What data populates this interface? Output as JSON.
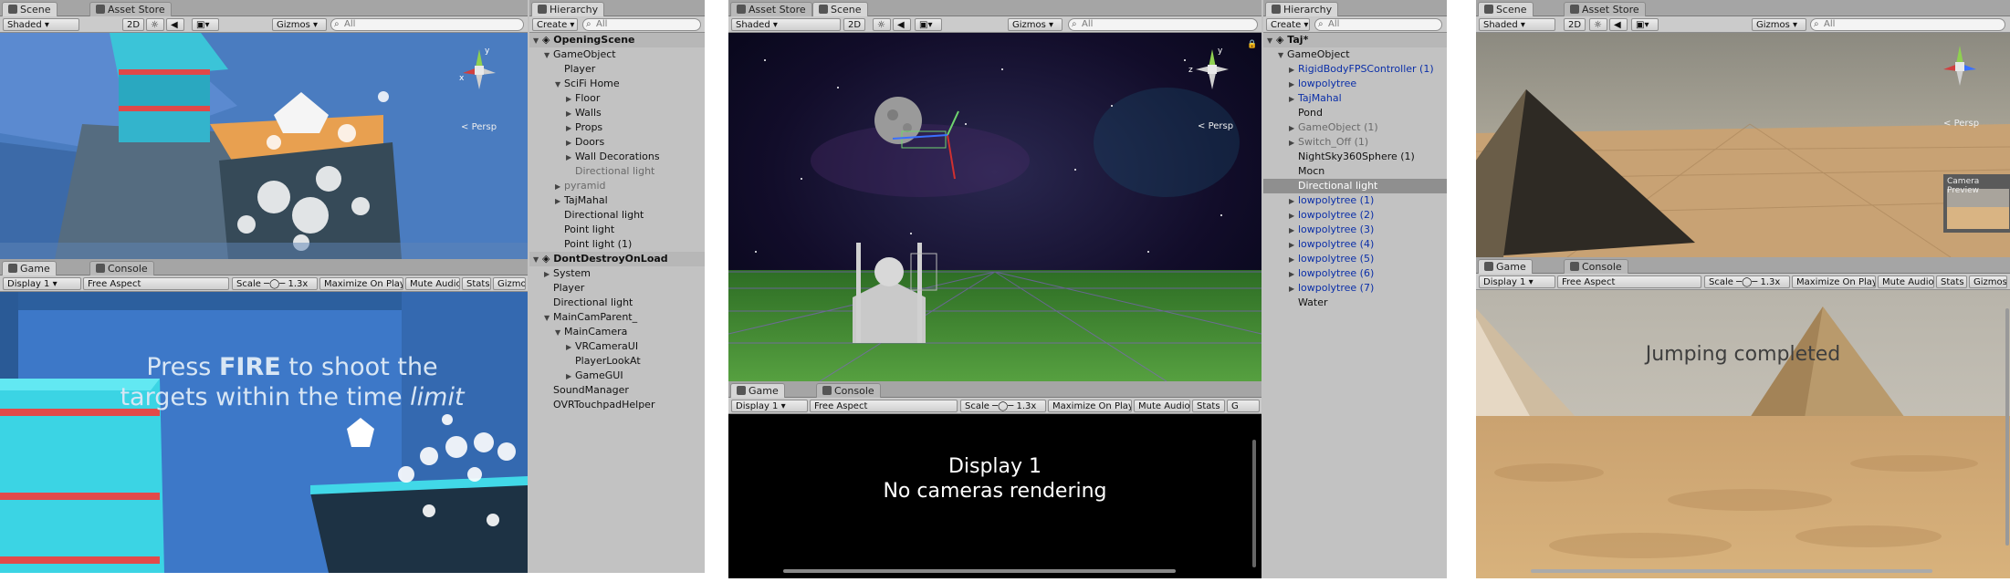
{
  "left": {
    "scene_tabs": [
      "Scene",
      "Asset Store"
    ],
    "scene_toolbar": {
      "shading": "Shaded",
      "mode2d": "2D",
      "gizmos": "Gizmos",
      "search_placeholder": "All"
    },
    "persp": "Persp",
    "game_tabs": [
      "Game",
      "Console"
    ],
    "game_toolbar": {
      "display": "Display 1",
      "aspect": "Free Aspect",
      "scale_label": "Scale",
      "scale_value": "1.3x",
      "maximize": "Maximize On Play",
      "mute": "Mute Audio",
      "stats": "Stats",
      "gizmos": "Gizmos"
    },
    "game_text_line1_pre": "Press ",
    "game_text_line1_bold": "FIRE",
    "game_text_line1_post": " to shoot the",
    "game_text_line2_pre": "targets within the time ",
    "game_text_line2_ital": "limit",
    "hierarchy": {
      "tab": "Hierarchy",
      "create": "Create",
      "search_placeholder": "All",
      "rows": [
        {
          "label": "OpeningScene",
          "kind": "scene",
          "depth": 0,
          "arrow": "down"
        },
        {
          "label": "GameObject",
          "kind": "normal",
          "depth": 1,
          "arrow": "down"
        },
        {
          "label": "Player",
          "kind": "normal",
          "depth": 2,
          "arrow": ""
        },
        {
          "label": "SciFi Home",
          "kind": "normal",
          "depth": 2,
          "arrow": "down"
        },
        {
          "label": "Floor",
          "kind": "normal",
          "depth": 3,
          "arrow": "right"
        },
        {
          "label": "Walls",
          "kind": "normal",
          "depth": 3,
          "arrow": "right"
        },
        {
          "label": "Props",
          "kind": "normal",
          "depth": 3,
          "arrow": "right"
        },
        {
          "label": "Doors",
          "kind": "normal",
          "depth": 3,
          "arrow": "right"
        },
        {
          "label": "Wall Decorations",
          "kind": "normal",
          "depth": 3,
          "arrow": "right"
        },
        {
          "label": "Directional light",
          "kind": "grey",
          "depth": 3,
          "arrow": ""
        },
        {
          "label": "pyramid",
          "kind": "grey",
          "depth": 2,
          "arrow": "right"
        },
        {
          "label": "TajMahal",
          "kind": "normal",
          "depth": 2,
          "arrow": "right"
        },
        {
          "label": "Directional light",
          "kind": "normal",
          "depth": 2,
          "arrow": ""
        },
        {
          "label": "Point light",
          "kind": "normal",
          "depth": 2,
          "arrow": ""
        },
        {
          "label": "Point light (1)",
          "kind": "normal",
          "depth": 2,
          "arrow": ""
        },
        {
          "label": "DontDestroyOnLoad",
          "kind": "scene",
          "depth": 0,
          "arrow": "down"
        },
        {
          "label": "System",
          "kind": "normal",
          "depth": 1,
          "arrow": "right"
        },
        {
          "label": "Player",
          "kind": "normal",
          "depth": 1,
          "arrow": ""
        },
        {
          "label": "Directional light",
          "kind": "normal",
          "depth": 1,
          "arrow": ""
        },
        {
          "label": "MainCamParent_",
          "kind": "normal",
          "depth": 1,
          "arrow": "down"
        },
        {
          "label": "MainCamera",
          "kind": "normal",
          "depth": 2,
          "arrow": "down"
        },
        {
          "label": "VRCameraUI",
          "kind": "normal",
          "depth": 3,
          "arrow": "right"
        },
        {
          "label": "PlayerLookAt",
          "kind": "normal",
          "depth": 3,
          "arrow": ""
        },
        {
          "label": "GameGUI",
          "kind": "normal",
          "depth": 3,
          "arrow": "right"
        },
        {
          "label": "SoundManager",
          "kind": "normal",
          "depth": 1,
          "arrow": ""
        },
        {
          "label": "OVRTouchpadHelper",
          "kind": "normal",
          "depth": 1,
          "arrow": ""
        }
      ]
    }
  },
  "middle": {
    "scene_tabs": [
      "Asset Store",
      "Scene"
    ],
    "scene_toolbar": {
      "shading": "Shaded",
      "mode2d": "2D",
      "gizmos": "Gizmos",
      "search_placeholder": "All"
    },
    "persp": "Persp",
    "game_tabs": [
      "Game",
      "Console"
    ],
    "game_toolbar": {
      "display": "Display 1",
      "aspect": "Free Aspect",
      "scale_label": "Scale",
      "scale_value": "1.3x",
      "maximize": "Maximize On Play",
      "mute": "Mute Audio",
      "stats": "Stats",
      "gizmos": "G"
    },
    "game_message_line1": "Display 1",
    "game_message_line2": "No cameras rendering",
    "hierarchy": {
      "tab": "Hierarchy",
      "create": "Create",
      "search_placeholder": "All",
      "rows": [
        {
          "label": "Taj*",
          "kind": "scene",
          "depth": 0,
          "arrow": "down"
        },
        {
          "label": "GameObject",
          "kind": "normal",
          "depth": 1,
          "arrow": "down"
        },
        {
          "label": "RigidBodyFPSController (1)",
          "kind": "blue",
          "depth": 2,
          "arrow": "right"
        },
        {
          "label": "lowpolytree",
          "kind": "blue",
          "depth": 2,
          "arrow": "right"
        },
        {
          "label": "TajMahal",
          "kind": "blue",
          "depth": 2,
          "arrow": "right"
        },
        {
          "label": "Pond",
          "kind": "normal",
          "depth": 2,
          "arrow": ""
        },
        {
          "label": "GameObject (1)",
          "kind": "grey",
          "depth": 2,
          "arrow": "right"
        },
        {
          "label": "Switch_Off (1)",
          "kind": "grey",
          "depth": 2,
          "arrow": "right"
        },
        {
          "label": "NightSky360Sphere (1)",
          "kind": "normal",
          "depth": 2,
          "arrow": ""
        },
        {
          "label": "Mocn",
          "kind": "normal",
          "depth": 2,
          "arrow": ""
        },
        {
          "label": "Directional light",
          "kind": "sel",
          "depth": 2,
          "arrow": ""
        },
        {
          "label": "lowpolytree (1)",
          "kind": "blue",
          "depth": 2,
          "arrow": "right"
        },
        {
          "label": "lowpolytree (2)",
          "kind": "blue",
          "depth": 2,
          "arrow": "right"
        },
        {
          "label": "lowpolytree (3)",
          "kind": "blue",
          "depth": 2,
          "arrow": "right"
        },
        {
          "label": "lowpolytree (4)",
          "kind": "blue",
          "depth": 2,
          "arrow": "right"
        },
        {
          "label": "lowpolytree (5)",
          "kind": "blue",
          "depth": 2,
          "arrow": "right"
        },
        {
          "label": "lowpolytree (6)",
          "kind": "blue",
          "depth": 2,
          "arrow": "right"
        },
        {
          "label": "lowpolytree (7)",
          "kind": "blue",
          "depth": 2,
          "arrow": "right"
        },
        {
          "label": "Water",
          "kind": "normal",
          "depth": 2,
          "arrow": ""
        }
      ]
    }
  },
  "right": {
    "scene_tabs": [
      "Scene",
      "Asset Store"
    ],
    "scene_toolbar": {
      "shading": "Shaded",
      "mode2d": "2D",
      "gizmos": "Gizmos",
      "search_placeholder": "All"
    },
    "persp": "Persp",
    "camera_preview": "Camera Preview",
    "game_tabs": [
      "Game",
      "Console"
    ],
    "game_toolbar": {
      "display": "Display 1",
      "aspect": "Free Aspect",
      "scale_label": "Scale",
      "scale_value": "1.3x",
      "maximize": "Maximize On Play",
      "mute": "Mute Audio",
      "stats": "Stats",
      "gizmos": "Gizmos"
    },
    "game_message": "Jumping completed"
  }
}
